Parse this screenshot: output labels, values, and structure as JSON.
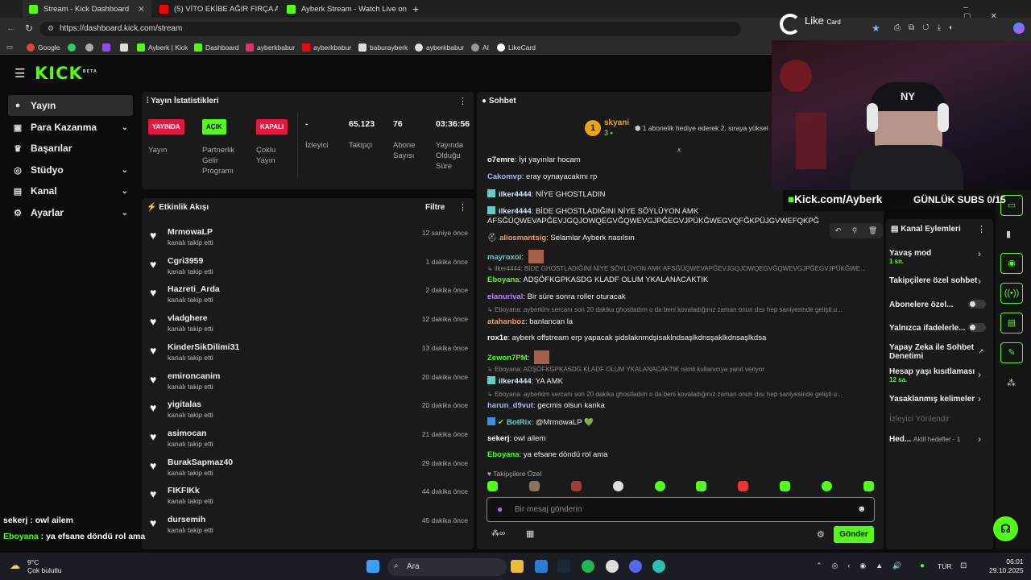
{
  "browser": {
    "tabs": [
      {
        "title": "Stream - Kick Dashboard"
      },
      {
        "title": "(5) VİTO EKİBE AĞIR FIRÇA ATIYOR"
      },
      {
        "title": "Ayberk Stream - Watch Live on K"
      }
    ],
    "url": "https://dashboard.kick.com/stream",
    "bookmarks": [
      "Google",
      "",
      "",
      "",
      "",
      "Ayberk | Kick",
      "Dashboard",
      "ayberkbabur",
      "ayberkbabur",
      "baburayberk",
      "ayberkbabur",
      "AI",
      "LikeCard"
    ]
  },
  "overlay": {
    "likecard": "Like",
    "likecard_small": "Card",
    "channel": "Kick.com/Ayberk",
    "subs": "GÜNLÜK SUBS 0/15",
    "cap_tag": "NY"
  },
  "sidebar": {
    "items": [
      {
        "label": "Yayın"
      },
      {
        "label": "Para Kazanma"
      },
      {
        "label": "Başarılar"
      },
      {
        "label": "Stüdyo"
      },
      {
        "label": "Kanal"
      },
      {
        "label": "Ayarlar"
      }
    ]
  },
  "stats": {
    "title": "Yayın İstatistikleri",
    "yayinda": "YAYINDA",
    "yayin": "Yayın",
    "acik": "AÇIK",
    "partner": "Partnerlik Gelir Programı",
    "kapali": "KAPALI",
    "coklu": "Çoklu Yayın",
    "viewers_val": "-",
    "viewers": "İzleyici",
    "followers_val": "65.123",
    "followers": "Takipçi",
    "subs_val": "76",
    "subs": "Abone Sayısı",
    "uptime_val": "03:36:56",
    "uptime": "Yayında Olduğu Süre"
  },
  "activity": {
    "title": "Etkinlik Akışı",
    "filter": "Filtre",
    "items": [
      {
        "name": "MrmowaLP",
        "action": "kanalı takip etti",
        "time": "12 saniye önce"
      },
      {
        "name": "Cgri3959",
        "action": "kanalı takip etti",
        "time": "1 dakika önce"
      },
      {
        "name": "Hazreti_Arda",
        "action": "kanalı takip etti",
        "time": "2 dakika önce"
      },
      {
        "name": "vladghere",
        "action": "kanalı takip etti",
        "time": "12 dakika önce"
      },
      {
        "name": "KinderSikDilimi31",
        "action": "kanalı takip etti",
        "time": "13 dakika önce"
      },
      {
        "name": "emironcanim",
        "action": "kanalı takip etti",
        "time": "20 dakika önce"
      },
      {
        "name": "yigitalas",
        "action": "kanalı takip etti",
        "time": "20 dakika önce"
      },
      {
        "name": "asimocan",
        "action": "kanalı takip etti",
        "time": "21 dakika önce"
      },
      {
        "name": "BurakSapmaz40",
        "action": "kanalı takip etti",
        "time": "29 dakika önce"
      },
      {
        "name": "FIKFIKk",
        "action": "kanalı takip etti",
        "time": "44 dakika önce"
      },
      {
        "name": "dursemih",
        "action": "kanalı takip etti",
        "time": "45 dakika önce"
      }
    ]
  },
  "chat": {
    "title": "Sohbet",
    "pinned_user": "skyani",
    "pinned_count": "3",
    "pinned_text": "1 abonelik hediye ederek 2. sıraya yüksel",
    "messages": [
      {
        "user": "o7emre",
        "text": "İyi yayınlar hocam",
        "color": "#ffffff"
      },
      {
        "user": "Cakomvp",
        "text": "eray oynayacakmı rp",
        "color": "#a4b4ff"
      },
      {
        "user": "ilker4444",
        "text": "NİYE GHOSTLADIN",
        "color": "#cfe3ff"
      },
      {
        "user": "ilker4444",
        "text": "BİDE GHOSTLADIĞINI NİYE SÖYLÜYON AMK",
        "color": "#cfe3ff"
      },
      {
        "user": "",
        "text": "AFSĞÜQWEVAPĞEVJGQJOWQEGVĞQWEVGJPĞEGVJPÜKĞWEGVQFĞKPÜJGVWEFQKPĞ",
        "color": ""
      },
      {
        "user": "aliosmantsig",
        "text": "Selamlar Ayberk nasılsın",
        "color": "#ff9a3d"
      },
      {
        "user": "mayroxoi",
        "text": "",
        "color": "#5fd0c5"
      },
      {
        "user": "",
        "text": "ilker4444: BİDE GHOSTLADIĞINI NİYE SÖYLÜYON AMK AFSĞÜQWEVAPĞEVJGQJOWQEGVĞQWEVGJPĞEGVJPÜKĞWE...",
        "color": ""
      },
      {
        "user": "Eboyana",
        "text": "ADŞÖFKGPKASDG KLADF OLUM YKALANACAKTIK",
        "color": "#53fc18"
      },
      {
        "user": "elanurival",
        "text": "Bir süre sonra roller oturacak",
        "color": "#b388ff"
      },
      {
        "user": "",
        "text": "Eboyana: ayberkim sercanı son 20 dakika ghostladım o da beni kovaladığınız zaman onun dısı hep saniyesinde gelişti u...",
        "color": ""
      },
      {
        "user": "atahanboz",
        "text": "banlancan la",
        "color": "#ff9a3d"
      },
      {
        "user": "rox1e",
        "text": "ayberk offstream erp yapacak şidslaknmdşisaklndsaşlkdnsşaklkdnsaşlkdsa",
        "color": "#ffffff"
      },
      {
        "user": "Zewon7PM",
        "text": "",
        "color": "#53fc18"
      },
      {
        "user": "",
        "text": "Eboyana: ADŞÖFKGPKASDG KLADF OLUM YKALANACAKTIK isimli kullanıcıya yanıt veriyor",
        "color": ""
      },
      {
        "user": "ilker4444",
        "text": "YA AMK",
        "color": "#cfe3ff"
      },
      {
        "user": "",
        "text": "Eboyana: ayberkim sercanı son 20 dakika ghostladım o da beni kovaladığınız zaman onun dısı hep saniyesinde gelişti u...",
        "color": ""
      },
      {
        "user": "harun_d9vut",
        "text": "gecmis olsun kanka",
        "color": "#a4b4ff"
      },
      {
        "user": "BotRix",
        "text": "@MrmowaLP 💚",
        "color": "#5fd0c5"
      },
      {
        "user": "sekerj",
        "text": "owl ailem",
        "color": "#ffffff"
      },
      {
        "user": "Eboyana",
        "text": "ya efsane döndü rol ama",
        "color": "#53fc18"
      }
    ],
    "followers_only": "Takipçilere Özel",
    "placeholder": "Bir mesaj gönderin",
    "send": "Gönder"
  },
  "actions": {
    "title": "Kanal Eylemleri",
    "items": [
      {
        "label": "Yavaş mod",
        "sub": "1 sn."
      },
      {
        "label": "Takipçilere özel sohbet",
        "sub": ""
      },
      {
        "label": "Abonelere özel...",
        "sub": ""
      },
      {
        "label": "Yalnızca ifadelerle...",
        "sub": ""
      },
      {
        "label": "Yapay Zeka ile Sohbet Denetimi",
        "sub": ""
      },
      {
        "label": "Hesap yaşı kısıtlaması",
        "sub": "12 sa."
      },
      {
        "label": "Yasaklanmış kelimeler",
        "sub": ""
      },
      {
        "label": "İzleyici Yönlendir",
        "sub": ""
      },
      {
        "label": "Hed...",
        "sub": "Aktif hedefler - 1"
      }
    ]
  },
  "overlay_chat": [
    {
      "user": "sekerj",
      "text": " : owl ailem"
    },
    {
      "user": "Eboyana",
      "text": " : ya efsane döndü rol ama"
    }
  ],
  "taskbar": {
    "temp": "9°C",
    "weather": "Çok bulutlu",
    "search": "Ara",
    "lang": "TUR",
    "time": "06:01",
    "date": "29.10.2025"
  }
}
